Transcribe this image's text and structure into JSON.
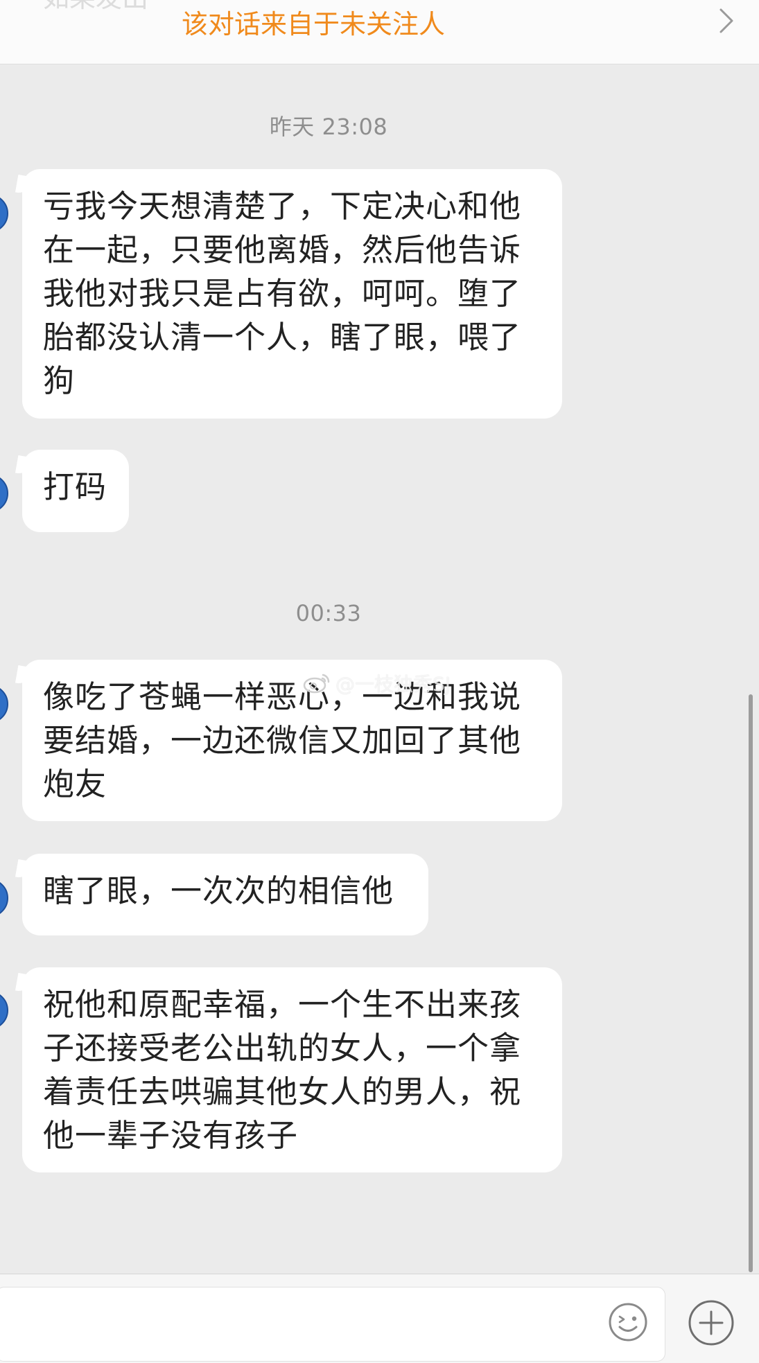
{
  "banner": {
    "partial_text": "如果发出",
    "notice": "该对话来自于未关注人"
  },
  "conversation": {
    "timestamps": [
      "昨天 23:08",
      "00:33"
    ],
    "messages": [
      "亏我今天想清楚了，下定决心和他在一起，只要他离婚，然后他告诉我他对我只是占有欲，呵呵。堕了胎都没认清一个人，瞎了眼，喂了狗",
      "打码",
      "像吃了苍蝇一样恶心，一边和我说要结婚，一边还微信又加回了其他炮友",
      "瞎了眼，一次次的相信他",
      "祝他和原配幸福，一个生不出来孩子还接受老公出轨的女人，一个拿着责任去哄骗其他女人的男人，祝他一辈子没有孩子"
    ]
  },
  "watermark": {
    "text": "@一枝独秀SJ"
  },
  "input": {
    "value": "",
    "placeholder": ""
  },
  "icons": {
    "banner_chevron": "chevron-right-icon",
    "emoji": "smiley-icon",
    "plus": "plus-circle-icon",
    "watermark_logo": "weibo-logo"
  },
  "colors": {
    "notice": "#f08a1c",
    "background": "#ebebeb",
    "bubble": "#ffffff",
    "avatar": "#2f6fc6"
  }
}
